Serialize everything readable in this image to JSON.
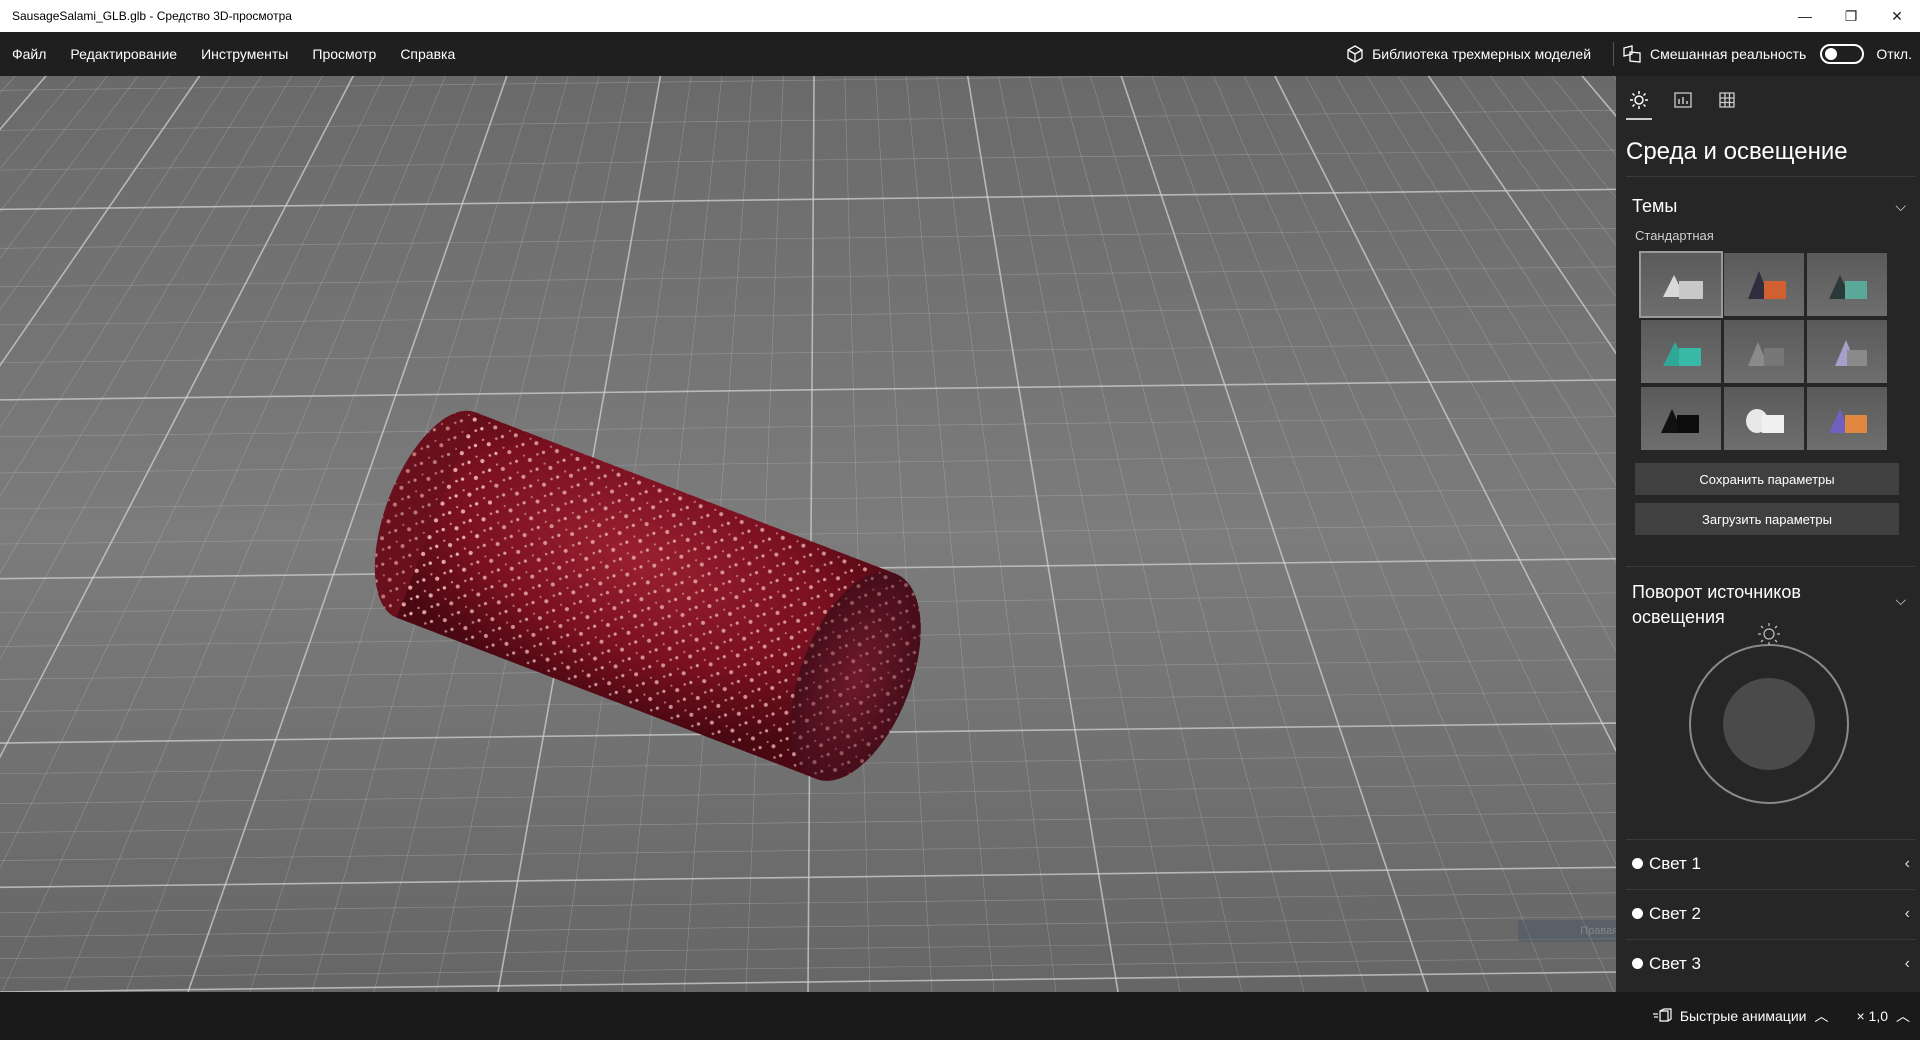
{
  "window": {
    "title": "SausageSalami_GLB.glb - Средство 3D-просмотра",
    "minimize_glyph": "—",
    "maximize_glyph": "❐",
    "close_glyph": "✕"
  },
  "menu": {
    "items": [
      "Файл",
      "Редактирование",
      "Инструменты",
      "Просмотр",
      "Справка"
    ],
    "library_label": "Библиотека трехмерных моделей",
    "library_icon": "cube-icon",
    "mixed_reality_label": "Смешанная реальность",
    "mixed_reality_icon": "mixed-reality-icon",
    "mixed_reality_state": "Откл."
  },
  "panel": {
    "tabs": [
      {
        "name": "environment-lighting",
        "icon": "sun-icon",
        "active": true
      },
      {
        "name": "statistics",
        "icon": "stats-icon",
        "active": false
      },
      {
        "name": "grid",
        "icon": "grid-icon",
        "active": false
      }
    ],
    "title": "Среда и освещение",
    "themes": {
      "heading": "Темы",
      "selected_label": "Стандартная",
      "count": 9
    },
    "save_button": "Сохранить параметры",
    "load_button": "Загрузить параметры",
    "rotation": {
      "heading_line1": "Поворот источников",
      "heading_line2": "освещения"
    },
    "lights": [
      "Свет 1",
      "Свет 2",
      "Свет 3"
    ]
  },
  "viewport": {
    "ghost_label": "Правая ссылка"
  },
  "statusbar": {
    "animations_label": "Быстрые анимации",
    "speed_label": "× 1,0"
  },
  "colors": {
    "accent_bg": "#262626",
    "button_bg": "#404040",
    "salami": "#7a1020"
  }
}
